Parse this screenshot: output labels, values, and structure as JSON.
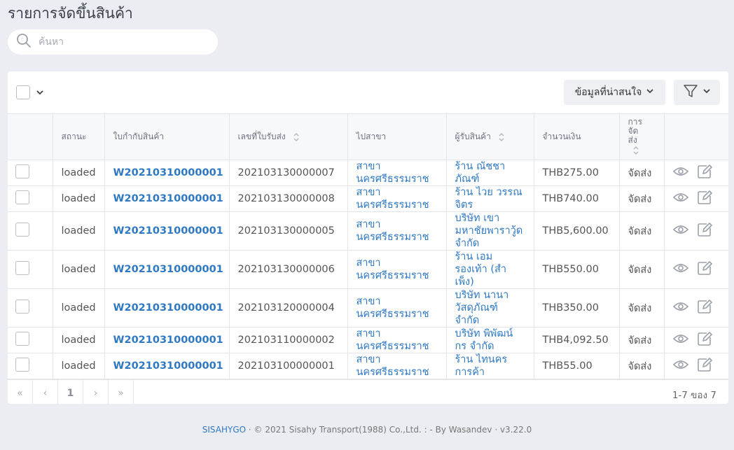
{
  "page": {
    "title": "รายการจัดขึ้นสินค้า"
  },
  "search": {
    "placeholder": "ค้นหา"
  },
  "toolbar": {
    "info_label": "ข้อมูลที่น่าสนใจ"
  },
  "columns": {
    "status": "สถานะ",
    "waybill": "ใบกำกับสินค้า",
    "receipt_no": "เลขที่ใบรับส่ง",
    "branch": "ไปสาขา",
    "receiver": "ผู้รับสินค้า",
    "amount": "จำนวนเงิน",
    "delivery": [
      "การ",
      "จัด",
      "ส่ง"
    ]
  },
  "rows": [
    {
      "status": "loaded",
      "waybill": "W20210310000001",
      "receipt_no": "202103130000007",
      "branch": "สาขา นครศรีธรรมราช",
      "receiver": "ร้าน ณัชชา ภัณฑ์",
      "amount": "THB275.00",
      "delivery": "จัดส่ง"
    },
    {
      "status": "loaded",
      "waybill": "W20210310000001",
      "receipt_no": "202103130000008",
      "branch": "สาขา นครศรีธรรมราช",
      "receiver": "ร้าน ไวย วรรณจิตร",
      "amount": "THB740.00",
      "delivery": "จัดส่ง"
    },
    {
      "status": "loaded",
      "waybill": "W20210310000001",
      "receipt_no": "202103130000005",
      "branch": "สาขา นครศรีธรรมราช",
      "receiver": "บริษัท เขา มหาชัยพาราวู้ด จำกัด",
      "amount": "THB5,600.00",
      "delivery": "จัดส่ง"
    },
    {
      "status": "loaded",
      "waybill": "W20210310000001",
      "receipt_no": "202103130000006",
      "branch": "สาขา นครศรีธรรมราช",
      "receiver": "ร้าน เอม รองเท้า (สำ เพ็ง)",
      "amount": "THB550.00",
      "delivery": "จัดส่ง"
    },
    {
      "status": "loaded",
      "waybill": "W20210310000001",
      "receipt_no": "202103120000004",
      "branch": "สาขา นครศรีธรรมราช",
      "receiver": "บริษัท นานา วัสดุภัณฑ์ จำกัด",
      "amount": "THB350.00",
      "delivery": "จัดส่ง"
    },
    {
      "status": "loaded",
      "waybill": "W20210310000001",
      "receipt_no": "202103110000002",
      "branch": "สาขา นครศรีธรรมราช",
      "receiver": "บริษัท พิพัฒน์ กร จำกัด",
      "amount": "THB4,092.50",
      "delivery": "จัดส่ง"
    },
    {
      "status": "loaded",
      "waybill": "W20210310000001",
      "receipt_no": "202103100000001",
      "branch": "สาขา นครศรีธรรมราช",
      "receiver": "ร้าน ไทนคร การค้า",
      "amount": "THB55.00",
      "delivery": "จัดส่ง"
    }
  ],
  "pagination": {
    "first": "«",
    "prev": "‹",
    "page": "1",
    "next": "›",
    "last": "»",
    "range": "1-7 ของ 7"
  },
  "footer": {
    "brand": "SISAHYGO",
    "sep": " · ",
    "copyright": "© 2021 Sisahy Transport(1988) Co.,Ltd. : - By Wasandev",
    "version": "v3.22.0"
  }
}
